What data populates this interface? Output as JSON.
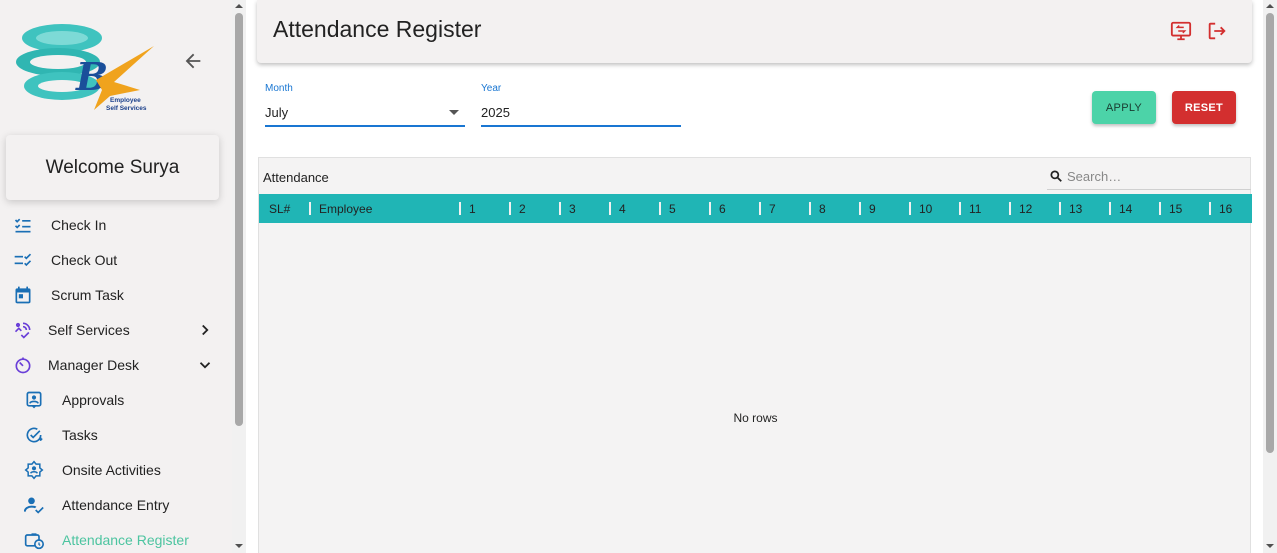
{
  "sidebar": {
    "logo_line1": "Employee",
    "logo_line2": "Self Services",
    "welcome": "Welcome Surya",
    "items": [
      {
        "label": "Check In",
        "icon": "checklist-icon"
      },
      {
        "label": "Check Out",
        "icon": "checklist-done-icon"
      },
      {
        "label": "Scrum Task",
        "icon": "calendar-icon"
      },
      {
        "label": "Self Services",
        "icon": "self-service-icon"
      },
      {
        "label": "Manager Desk",
        "icon": "timer-icon"
      },
      {
        "label": "Approvals",
        "icon": "approval-badge-icon"
      },
      {
        "label": "Tasks",
        "icon": "task-check-icon"
      },
      {
        "label": "Onsite Activities",
        "icon": "onsite-icon"
      },
      {
        "label": "Attendance Entry",
        "icon": "person-check-icon"
      },
      {
        "label": "Attendance Register",
        "icon": "briefcase-clock-icon"
      }
    ]
  },
  "header": {
    "title": "Attendance Register"
  },
  "filters": {
    "month_label": "Month",
    "month_value": "July",
    "year_label": "Year",
    "year_value": "2025",
    "apply_label": "APPLY",
    "reset_label": "RESET"
  },
  "grid": {
    "title": "Attendance",
    "search_placeholder": "Search…",
    "columns": [
      "SL#",
      "Employee",
      "1",
      "2",
      "3",
      "4",
      "5",
      "6",
      "7",
      "8",
      "9",
      "10",
      "11",
      "12",
      "13",
      "14",
      "15",
      "16"
    ],
    "empty_text": "No rows"
  },
  "colors": {
    "accent_teal": "#20b5b5",
    "apply_green": "#4cd3a8",
    "reset_red": "#d32f2f",
    "field_blue": "#1976d2",
    "icon_blue": "#1a6fb5",
    "active_green": "#4cc4a0",
    "header_icon_red": "#d32f2f"
  }
}
